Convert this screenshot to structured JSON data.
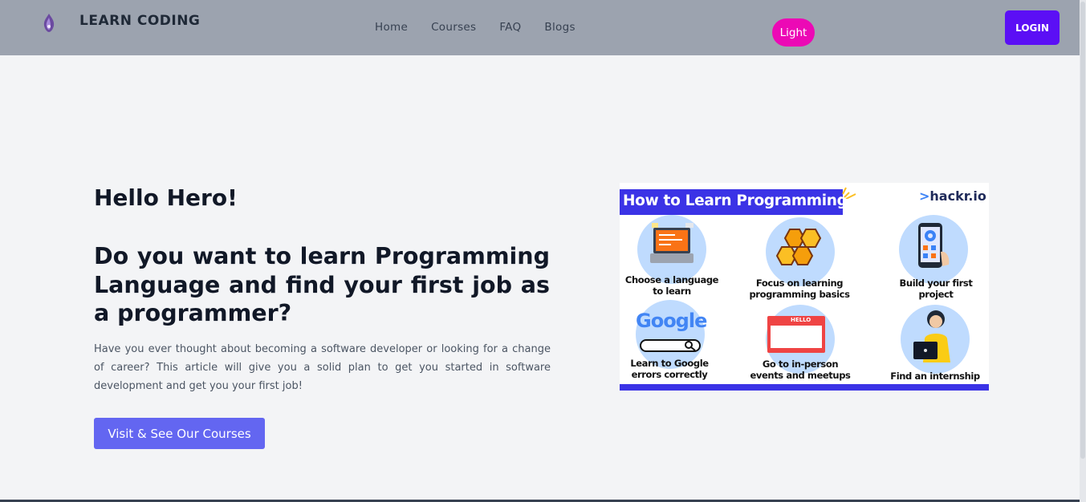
{
  "nav": {
    "brand": "LEARN CODING",
    "links": [
      "Home",
      "Courses",
      "FAQ",
      "Blogs"
    ],
    "theme_label": "Light",
    "login_label": "LOGIN",
    "colors": {
      "bar": "#9ca3af",
      "theme": "#ec09b5",
      "login": "#5b0ff5"
    }
  },
  "hero": {
    "greeting": "Hello Hero!",
    "title": "Do you want to learn Programming Language and find your first job as a programmer?",
    "description": "Have you ever thought about becoming a software developer or looking for a change of career? This article will give you a solid plan to get you started in software development and get you your first job!",
    "cta_label": "Visit & See Our Courses",
    "cta_color": "#6366f1"
  },
  "infographic": {
    "title": "How to Learn Programming",
    "logo": "hackr.io",
    "logo_prefix": ">",
    "steps": [
      {
        "line1": "Choose a language",
        "line2": "to learn",
        "icon": "laptop-code-icon"
      },
      {
        "line1": "Focus on learning",
        "line2": "programming basics",
        "icon": "hexagon-code-icon"
      },
      {
        "line1": "Build your first",
        "line2": "project",
        "icon": "phone-gear-icon"
      },
      {
        "line1": "Learn to Google",
        "line2": "errors correctly",
        "icon": "google-search-icon",
        "google_word": "Google"
      },
      {
        "line1": "Go to in-person",
        "line2": "events and meetups",
        "icon": "hello-badge-icon",
        "badge_text": "HELLO"
      },
      {
        "line1": "",
        "line2": "Find an internship",
        "icon": "person-laptop-icon"
      }
    ]
  }
}
